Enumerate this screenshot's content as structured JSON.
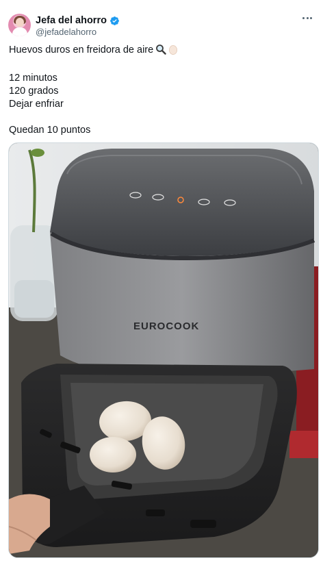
{
  "author": {
    "display_name": "Jefa del ahorro",
    "handle": "@jefadelahorro",
    "verified": true,
    "avatar_icon": "profile-avatar"
  },
  "tweet": {
    "line1": "Huevos duros en freidora de aire",
    "line1_emojis": [
      "magnifying-glass-icon",
      "egg-icon"
    ],
    "line2": "12 minutos",
    "line3": "120 grados",
    "line4": "Dejar enfriar",
    "line5": "Quedan 10 puntos"
  },
  "photo": {
    "brand_label": "EUROCOOK",
    "description_icon": "air-fryer-with-eggs"
  },
  "colors": {
    "text_primary": "#0f1419",
    "text_secondary": "#536471",
    "verified_blue": "#1d9bf0",
    "border": "#cfd9de"
  }
}
